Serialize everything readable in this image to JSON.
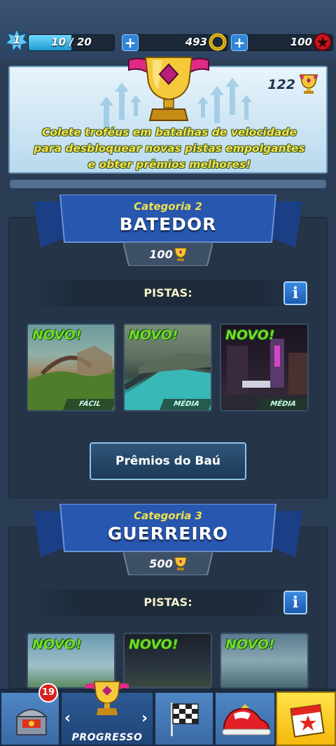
{
  "hud": {
    "level": "1",
    "xp_text": "10 / 20",
    "xp_progress": 0.5,
    "rings": "493",
    "tokens": "100"
  },
  "banner": {
    "trophy_count": "122",
    "text": "Colete troféus em batalhas de velocidade para desbloquear novas pistas empolgantes e obter prêmios melhores!"
  },
  "categories": [
    {
      "label": "Categoria 2",
      "title": "BATEDOR",
      "requirement": "100",
      "tracks_label": "PISTAS:",
      "tracks": [
        {
          "badge": "NOVO!",
          "difficulty": "FÁCIL"
        },
        {
          "badge": "NOVO!",
          "difficulty": "MÉDIA"
        },
        {
          "badge": "NOVO!",
          "difficulty": "MÉDIA"
        }
      ],
      "chest_button": "Prêmios do Baú"
    },
    {
      "label": "Categoria 3",
      "title": "GUERREIRO",
      "requirement": "500",
      "tracks_label": "PISTAS:",
      "tracks": [
        {
          "badge": "NOVO!"
        },
        {
          "badge": "NOVO!"
        },
        {
          "badge": "NOVO!"
        }
      ]
    }
  ],
  "info_glyph": "i",
  "nav": {
    "chest_badge": "19",
    "progress_label": "PROGRESSO",
    "prev_arrow": "‹",
    "next_arrow": "›"
  },
  "icons": [
    "star-level-icon",
    "ring-icon",
    "red-token-icon",
    "trophy-icon",
    "chest-icon",
    "checkered-flag-icon",
    "sneaker-icon",
    "calendar-icon"
  ]
}
